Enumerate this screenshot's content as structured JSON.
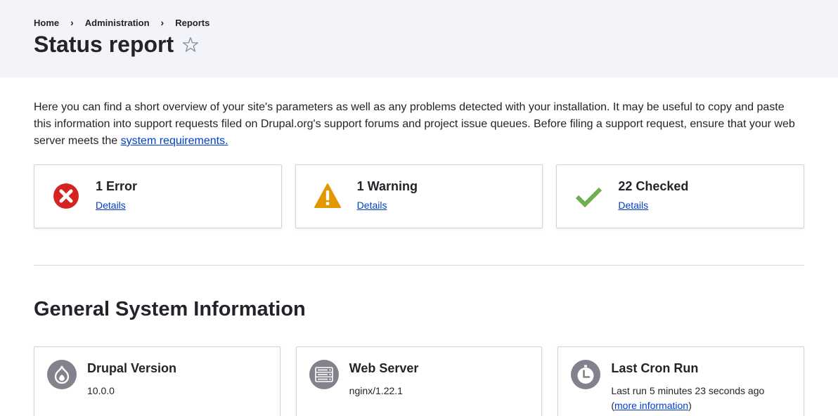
{
  "breadcrumb": {
    "items": [
      "Home",
      "Administration",
      "Reports"
    ],
    "separator": "›"
  },
  "page": {
    "title": "Status report",
    "star_icon": "star-outline-icon"
  },
  "intro": {
    "text": "Here you can find a short overview of your site's parameters as well as any problems detected with your installation. It may be useful to copy and paste this information into support requests filed on Drupal.org's support forums and project issue queues. Before filing a support request, ensure that your web server meets the ",
    "link_text": "system requirements."
  },
  "status": {
    "error": {
      "count_label": "1 Error",
      "details_label": "Details",
      "icon": "error-icon",
      "color": "#d72222"
    },
    "warning": {
      "count_label": "1 Warning",
      "details_label": "Details",
      "icon": "warning-icon",
      "color": "#e29700"
    },
    "checked": {
      "count_label": "22 Checked",
      "details_label": "Details",
      "icon": "check-icon",
      "color": "#6eaf51"
    }
  },
  "general": {
    "title": "General System Information",
    "cards": {
      "drupal": {
        "heading": "Drupal Version",
        "value": "10.0.0",
        "icon": "drupal-icon"
      },
      "webserver": {
        "heading": "Web Server",
        "value": "nginx/1.22.1",
        "icon": "server-icon"
      },
      "cron": {
        "heading": "Last Cron Run",
        "value": "Last run 5 minutes 23 seconds ago",
        "link_prefix": "(",
        "link_text": "more information",
        "link_suffix": ")",
        "icon": "clock-icon"
      }
    }
  },
  "colors": {
    "link": "#003ecc",
    "header_bg": "#f3f4f9",
    "icon_circle": "#82828c"
  }
}
